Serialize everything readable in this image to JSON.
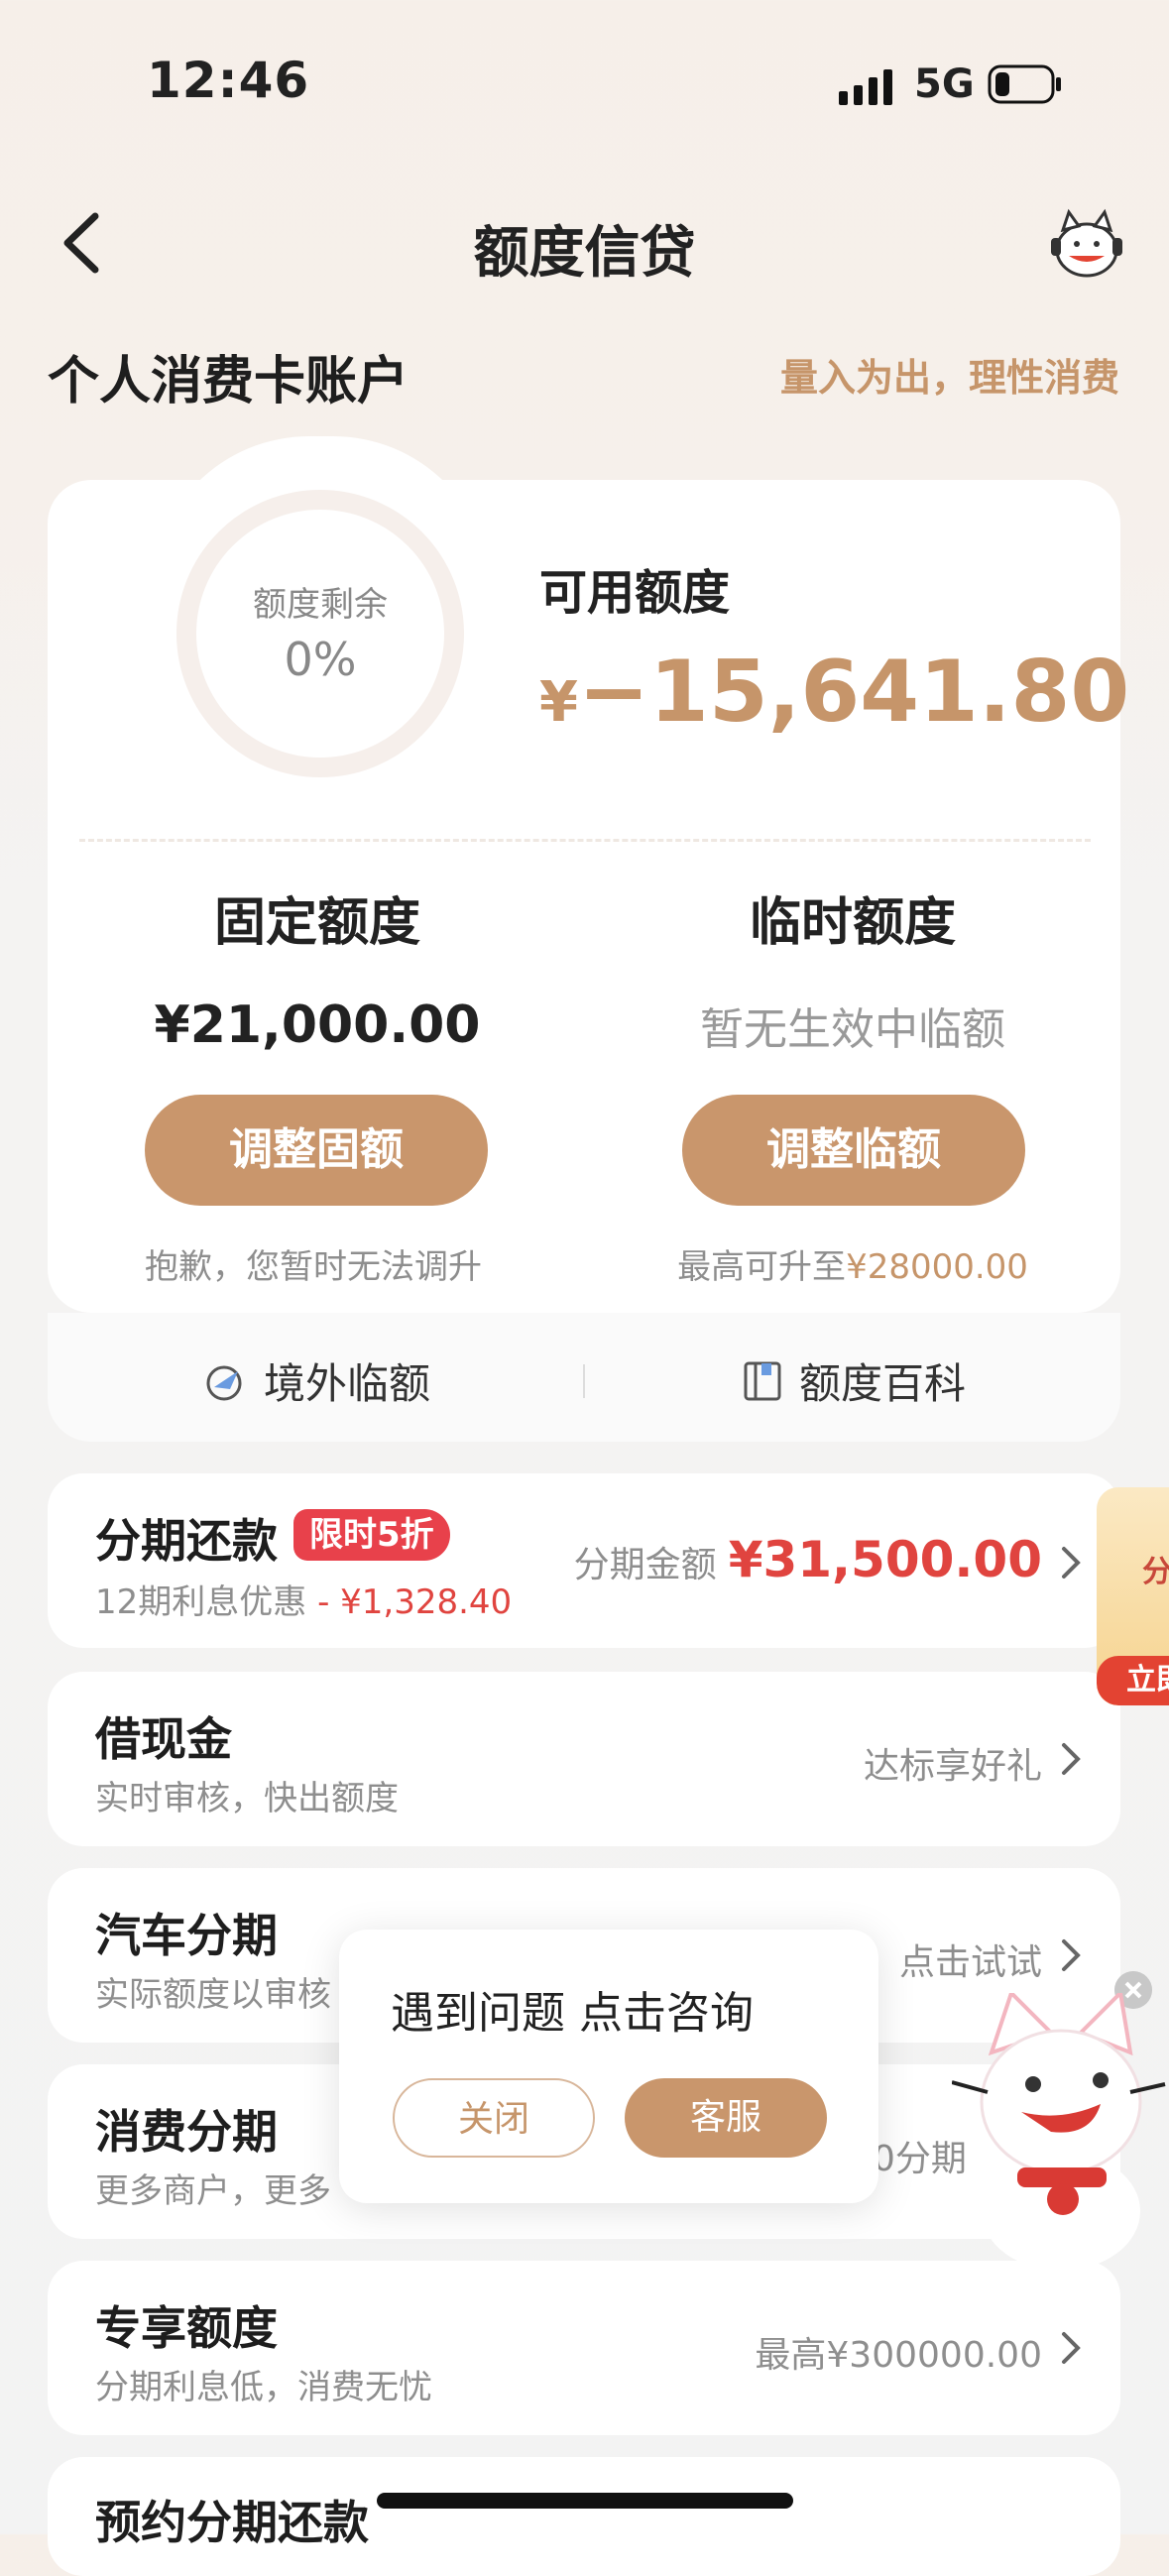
{
  "status_bar": {
    "time": "12:46",
    "network": "5G"
  },
  "nav": {
    "title": "额度信贷"
  },
  "account": {
    "title": "个人消费卡账户",
    "slogan": "量入为出，理性消费"
  },
  "credit": {
    "ring_label": "额度剩余",
    "ring_value": "0%",
    "available_label": "可用额度",
    "available_currency": "¥",
    "available_value": "−15,641.80",
    "fixed": {
      "title": "固定额度",
      "amount": "¥21,000.00",
      "button": "调整固额",
      "hint": "抱歉，您暂时无法调升"
    },
    "temp": {
      "title": "临时额度",
      "status": "暂无生效中临额",
      "button": "调整临额",
      "hint_prefix": "最高可升至",
      "hint_amount": "¥28000.00"
    },
    "links": {
      "overseas": "境外临额",
      "wiki": "额度百科"
    }
  },
  "list": [
    {
      "title": "分期还款",
      "badge": "限时5折",
      "subtitle": "12期利息优惠",
      "subtitle_red": " - ¥1,328.40",
      "right_label": "分期金额",
      "right_amount": "¥31,500.00"
    },
    {
      "title": "借现金",
      "subtitle": "实时审核，快出额度",
      "right": "达标享好礼"
    },
    {
      "title": "汽车分期",
      "subtitle": "实际额度以审核",
      "right": "点击试试"
    },
    {
      "title": "消费分期",
      "subtitle": "更多商户，更多",
      "right": "0分期"
    },
    {
      "title": "专享额度",
      "subtitle": "分期利息低，消费无忧",
      "right": "最高¥300000.00"
    },
    {
      "title": "预约分期还款"
    }
  ],
  "promo": {
    "text": "分",
    "button": "立即"
  },
  "popup": {
    "message": "遇到问题 点击咨询",
    "close": "关闭",
    "service": "客服"
  }
}
